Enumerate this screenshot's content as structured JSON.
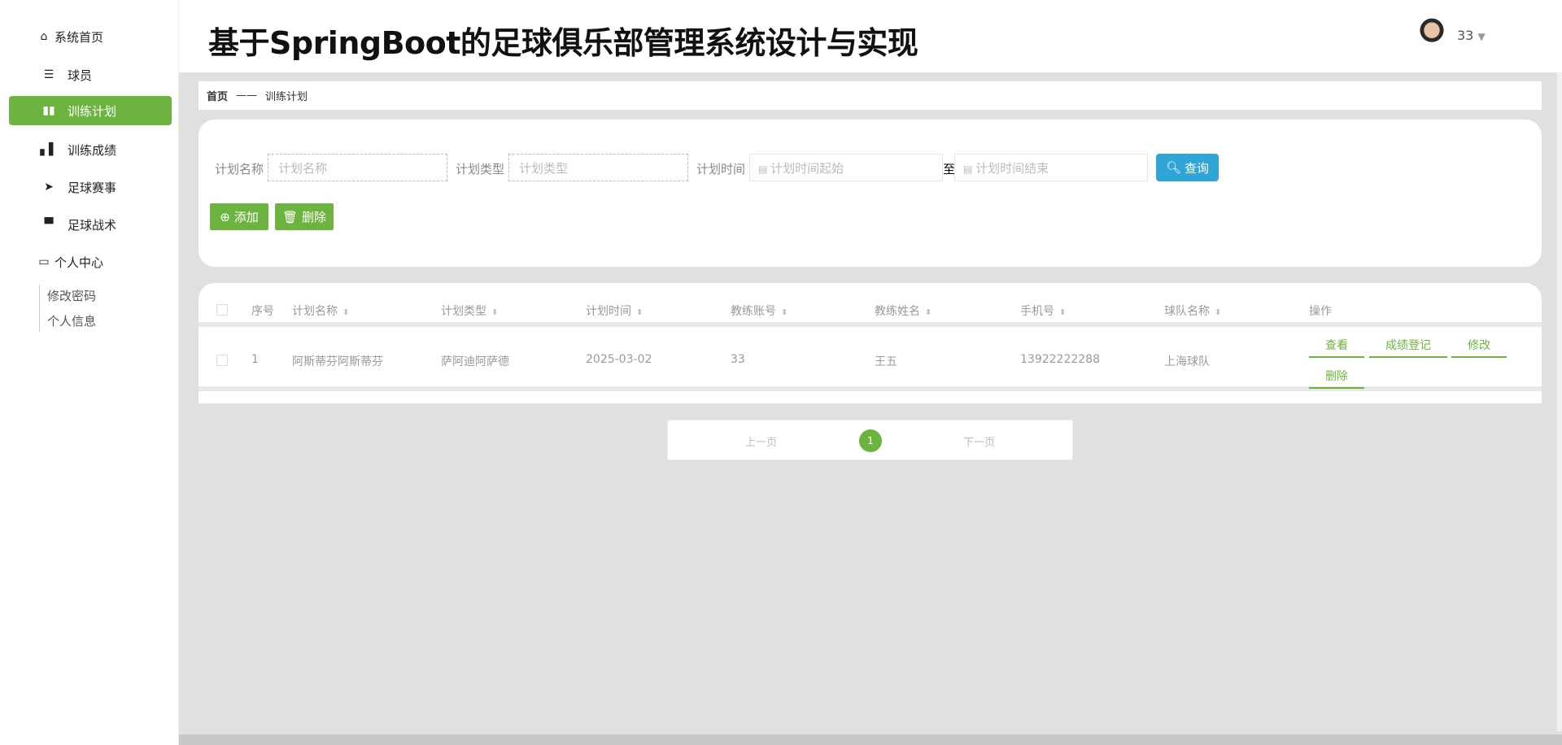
{
  "title": "基于SpringBoot的足球俱乐部管理系统设计与实现",
  "user": {
    "name": "33"
  },
  "sidebar": {
    "items": [
      {
        "label": "系统首页",
        "icon": "home-icon"
      },
      {
        "label": "球员",
        "icon": "sliders-icon"
      },
      {
        "label": "训练计划",
        "icon": "book-icon"
      },
      {
        "label": "训练成绩",
        "icon": "bar-chart-icon"
      },
      {
        "label": "足球赛事",
        "icon": "paper-plane-icon"
      },
      {
        "label": "足球战术",
        "icon": "brush-icon"
      },
      {
        "label": "个人中心",
        "icon": "wallet-icon"
      }
    ],
    "sub": [
      "修改密码",
      "个人信息"
    ]
  },
  "breadcrumb": {
    "home": "首页",
    "sep": "——",
    "current": "训练计划"
  },
  "search": {
    "name_label": "计划名称",
    "name_placeholder": "计划名称",
    "type_label": "计划类型",
    "type_placeholder": "计划类型",
    "time_label": "计划时间",
    "start_placeholder": "计划时间起始",
    "to": "至",
    "end_placeholder": "计划时间结束",
    "query": "查询",
    "add": "添加",
    "delete": "删除"
  },
  "table": {
    "headers": [
      "序号",
      "计划名称",
      "计划类型",
      "计划时间",
      "教练账号",
      "教练姓名",
      "手机号",
      "球队名称",
      "操作"
    ],
    "rows": [
      {
        "cells": [
          "1",
          "阿斯蒂芬阿斯蒂芬",
          "萨阿迪阿萨德",
          "2025-03-02",
          "33",
          "王五",
          "13922222288",
          "上海球队"
        ]
      }
    ],
    "actions": [
      "查看",
      "成绩登记",
      "修改",
      "删除"
    ]
  },
  "pager": {
    "prev": "上一页",
    "page": "1",
    "next": "下一页"
  },
  "colors": {
    "accent": "#6db33f",
    "query": "#2fa4d7"
  }
}
